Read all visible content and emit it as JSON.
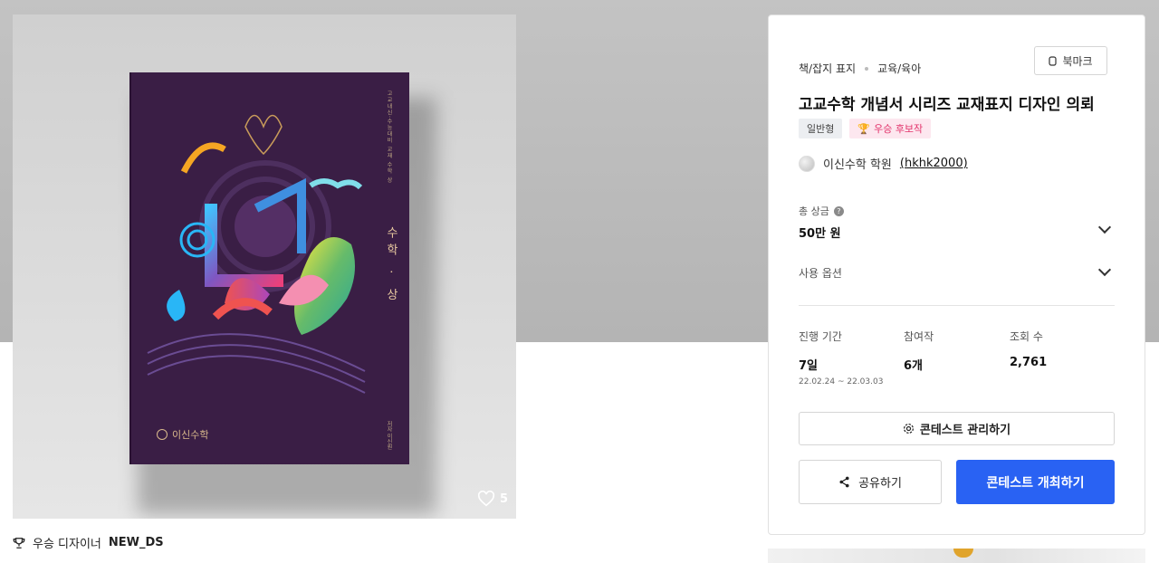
{
  "hero": {
    "book": {
      "spine_text": "고교내신·수능대비 교재 수학 상",
      "vertical_title": "수학 · 상",
      "brand": "이신수학",
      "author": "저자 이신원"
    },
    "like_count": "5",
    "winner_prefix": "우승 디자이너",
    "winner_name": "NEW_DS"
  },
  "panel": {
    "category1": "책/잡지 표지",
    "category2": "교육/육아",
    "bookmark_label": "북마크",
    "title": "고교수학 개념서 시리즈 교재표지 디자인 의뢰",
    "badge_type": "일반형",
    "badge_winner": "우승 후보작",
    "host_name": "이신수학 학원",
    "host_id": "(hkhk2000)",
    "prize_label": "총 상금",
    "prize_value": "50만 원",
    "usage_label": "사용 옵션",
    "stats": {
      "period_label": "진행 기간",
      "period_value": "7일",
      "period_dates": "22.02.24 ~ 22.03.03",
      "entries_label": "참여작",
      "entries_value": "6개",
      "views_label": "조회 수",
      "views_value": "2,761"
    },
    "manage_label": "콘테스트 관리하기",
    "share_label": "공유하기",
    "open_label": "콘테스트 개최하기"
  },
  "colors": {
    "primary": "#2962f3",
    "book_purple": "#3a1e45",
    "badge_pink": "#e2336b"
  }
}
